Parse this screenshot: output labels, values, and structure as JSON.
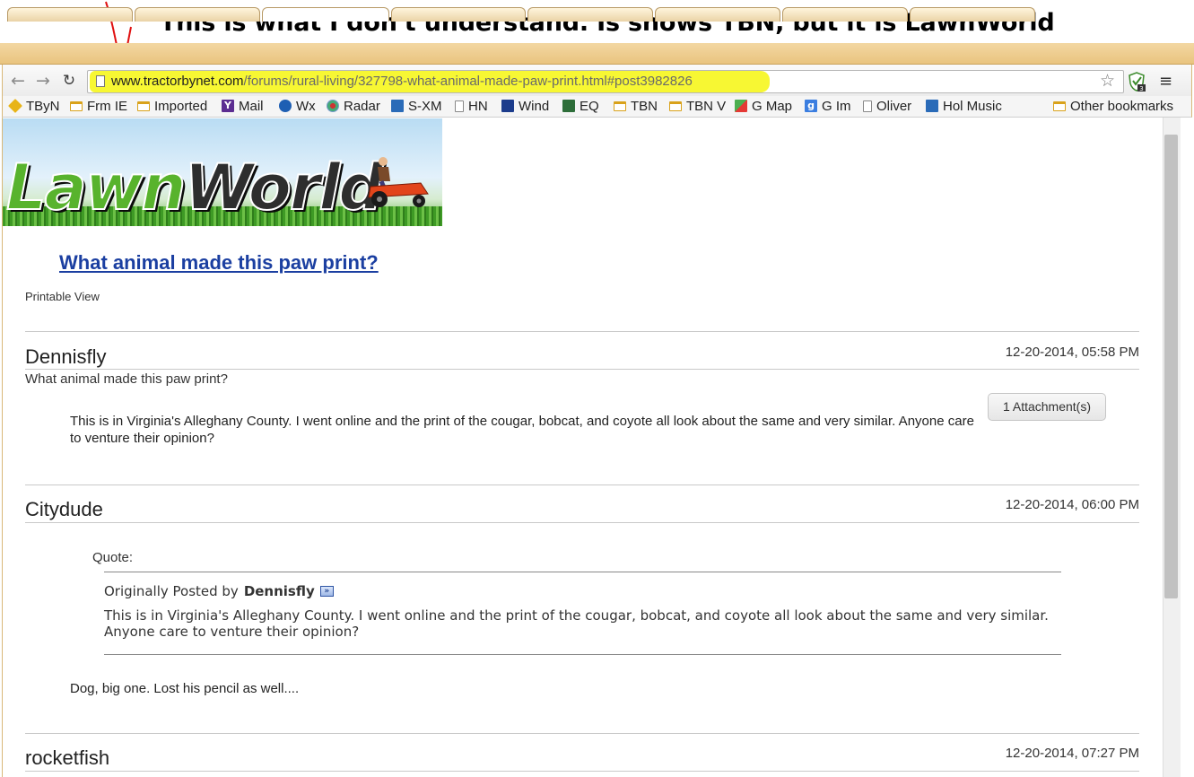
{
  "annotation": {
    "caption": "This is what I don't understand. Is shows TBN, but it is LawnWorld"
  },
  "browser": {
    "url_host": "www.tractorbynet.com",
    "url_path": "/forums/rural-living/327798-what-animal-made-paw-print.html#post3982826",
    "extension_badge": "3",
    "bookmarks": [
      {
        "label": "TByN",
        "icon": "tbyn-icon"
      },
      {
        "label": "Frm IE",
        "icon": "folder-icon"
      },
      {
        "label": "Imported",
        "icon": "folder-icon"
      },
      {
        "label": "Mail",
        "icon": "yahoo-icon"
      },
      {
        "label": "Wx",
        "icon": "noaa-icon"
      },
      {
        "label": "Radar",
        "icon": "radar-icon"
      },
      {
        "label": "S-XM",
        "icon": "siriusxm-icon"
      },
      {
        "label": "HN",
        "icon": "page-icon"
      },
      {
        "label": "Wind",
        "icon": "weather-channel-icon"
      },
      {
        "label": "EQ",
        "icon": "eq-icon"
      },
      {
        "label": "TBN",
        "icon": "folder-icon"
      },
      {
        "label": "TBN V",
        "icon": "folder-icon"
      },
      {
        "label": "G Map",
        "icon": "google-maps-icon"
      },
      {
        "label": "G Im",
        "icon": "google-icon"
      },
      {
        "label": "Oliver",
        "icon": "page-icon"
      },
      {
        "label": "Hol Music",
        "icon": "siriusxm-icon"
      }
    ],
    "other_bookmarks": "Other bookmarks"
  },
  "page": {
    "banner_logo_part1": "Lawn",
    "banner_logo_part2": "World",
    "thread_title": "What animal made this paw print?",
    "printable_view": "Printable View",
    "posts": [
      {
        "author": "Dennisfly",
        "date": "12-20-2014, 05:58 PM",
        "subject": "What animal made this paw print?",
        "body": "This is in Virginia's Alleghany County. I went online and the print of the cougar, bobcat, and coyote all look about the same and very similar. Anyone care to venture their opinion?",
        "attachment_label": "1 Attachment(s)"
      },
      {
        "author": "Citydude",
        "date": "12-20-2014, 06:00 PM",
        "quote_label": "Quote:",
        "quote_by_prefix": "Originally Posted by",
        "quote_author": "Dennisfly",
        "quote_text": "This is in Virginia's Alleghany County. I went online and the print of the cougar, bobcat, and coyote all look about the same and very similar. Anyone care to venture their opinion?",
        "body": "Dog, big one. Lost his pencil as well...."
      },
      {
        "author": "rocketfish",
        "date": "12-20-2014, 07:27 PM"
      }
    ]
  },
  "colors": {
    "url_highlight": "#f7f733",
    "title_link": "#1b3fa1",
    "annotation_arrow": "#e01010"
  }
}
